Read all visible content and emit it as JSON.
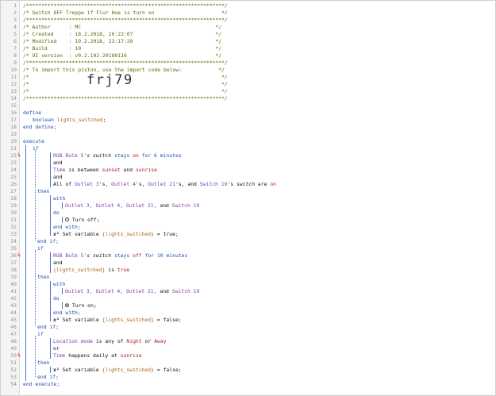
{
  "header": {
    "rule": "/*****************************************************************/",
    "title_line": "/* Switch OFF Treppe if Flur Hue is turn on                      */",
    "author": "/* Author      : MC                                            */",
    "created": "/* Created     : 18.2.2018, 20:22:07                           */",
    "modified": "/* Modified    : 19.2.2018, 23:17:29                           */",
    "build": "/* Build       : 10                                            */",
    "ui_version": "/* UI version  : v0.2.102.20180116                             */",
    "import_line": "/* To import this piston, use the import code below:            */",
    "blank": "/*                                                               */",
    "import_code": "frj79",
    "closing": "*/"
  },
  "gutter": {
    "lines": [
      "1",
      "2",
      "3",
      "4",
      "5",
      "6",
      "7",
      "8",
      "9",
      "10",
      "11",
      "12",
      "13",
      "14",
      "15",
      "16",
      "17",
      "18",
      "19",
      "20",
      "21",
      "22",
      "23",
      "24",
      "25",
      "26",
      "27",
      "28",
      "29",
      "30",
      "31",
      "32",
      "33",
      "34",
      "35",
      "36",
      "37",
      "38",
      "39",
      "40",
      "41",
      "42",
      "43",
      "44",
      "45",
      "46",
      "47",
      "48",
      "49",
      "50",
      "51",
      "52",
      "53",
      "54"
    ],
    "trigger_mark": "ϟ"
  },
  "code": {
    "define": "define",
    "boolean": "boolean",
    "var_lights": "lights_switched",
    "semicolon": ";",
    "end_define": "end define;",
    "execute": "execute",
    "if": "if",
    "then": "then",
    "end_if": "end if;",
    "with": "with",
    "do": "do",
    "end_with": "end with;",
    "and": "and",
    "or": "or",
    "end_execute": "end execute;",
    "rgb_bulb": "RGB Bulb 5",
    "s_switch": "'s switch",
    "stays": "stays",
    "on": "on",
    "off": "off",
    "for_6": "for 6 minutes",
    "for_10": "for 10 minutes",
    "time": "Time",
    "is_between": "is between",
    "sunset": "sunset",
    "and_word": "and",
    "sunrise": "sunrise",
    "all_of": "All of",
    "outlet3s": "Outlet 3",
    "outlet4s": "Outlet 4",
    "outlet21s": "Outlet 21",
    "switch19s": "Switch 19",
    "s": "'s",
    "s_comma": "'s,",
    "s_and": "'s, and",
    "switch_word": "switch",
    "are": "are",
    "turn_off": "Turn off;",
    "turn_on": "Turn on;",
    "set_var": "Set variable",
    "lights_sw": "{lights_switched}",
    "eq_true": "= true;",
    "eq_false": "= false;",
    "is": "is",
    "true_val": "true",
    "location_mode": "Location mode",
    "is_any_of": "is any of",
    "night": "Night",
    "away": "Away",
    "happens_daily_at": "happens daily at",
    "outlet3": "Outlet 3,",
    "outlet4": "Outlet 4,",
    "outlet21": "Outlet 21,",
    "and_switch": "and",
    "switch19": "Switch 19"
  }
}
